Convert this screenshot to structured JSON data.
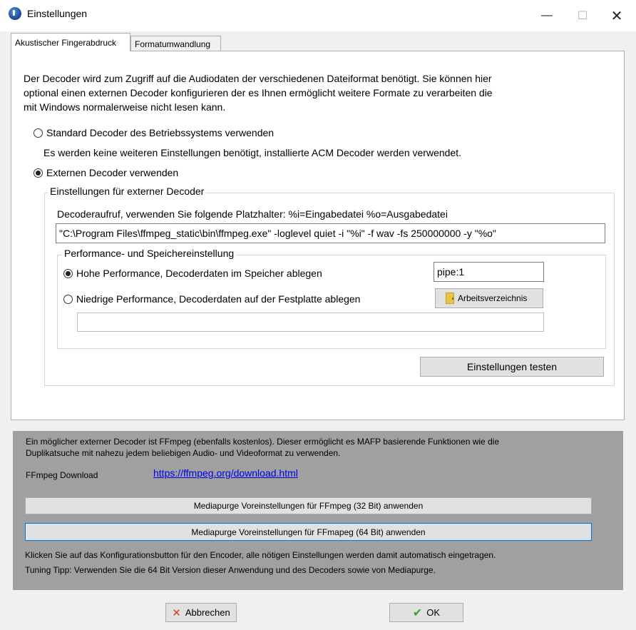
{
  "window": {
    "title": "Einstellungen",
    "minimize_glyph": "—",
    "maximize_glyph": "☐",
    "close_glyph": "✕"
  },
  "tabs": [
    {
      "label": "Akustischer Fingerabdruck",
      "active": true
    },
    {
      "label": "Formatumwandlung",
      "active": false
    }
  ],
  "decoder": {
    "intro_line1": "Der Decoder wird zum Zugriff auf die Audiodaten der verschiedenen Dateiformat benötigt.  Sie können hier",
    "intro_line2": "optional einen externen Decoder konfigurieren der es Ihnen ermöglicht weitere Formate zu verarbeiten die",
    "intro_line3": "mit Windows normalerweise nicht lesen kann.",
    "radio_standard": "Standard Decoder des Betriebssystems verwenden",
    "standard_note": "Es werden keine weiteren Einstellungen benötigt, installierte ACM Decoder werden verwendet.",
    "radio_external": "Externen Decoder verwenden",
    "selected": "external"
  },
  "external": {
    "group_title": "Einstellungen für externer Decoder",
    "call_label": "Decoderaufruf, verwenden Sie folgende Platzhalter: %i=Eingabedatei %o=Ausgabedatei",
    "command_value": "\"C:\\Program Files\\ffmpeg_static\\bin\\ffmpeg.exe\" -loglevel quiet -i \"%i\" -f wav -fs 250000000 -y \"%o\"",
    "perf_group_title": "Performance- und Speichereinstellung",
    "radio_high": "Hohe Performance, Decoderdaten im Speicher ablegen",
    "pipe_value": "pipe:1",
    "radio_low": "Niedrige Performance, Decoderdaten auf der Festplatte ablegen",
    "workdir_button": "Arbeitsverzeichnis",
    "workdir_value": "",
    "perf_selected": "high",
    "test_button": "Einstellungen testen"
  },
  "info": {
    "line1": "Ein möglicher externer Decoder ist FFmpeg (ebenfalls kostenlos). Dieser ermöglicht es MAFP basierende Funktionen wie die",
    "line2": "Duplikatsuche mit nahezu jedem beliebigen Audio- und Videoformat zu verwenden.",
    "download_label": "FFmpeg Download",
    "download_link": "https://ffmpeg.org/download.html",
    "btn_32": "Mediapurge Voreinstellungen für FFmpeg (32 Bit) anwenden",
    "btn_64": "Mediapurge Voreinstellungen für FFmapeg (64 Bit) anwenden",
    "hint1": "Klicken Sie auf das Konfigurationsbutton für den Encoder, alle nötigen Einstellungen werden damit automatisch eingetragen.",
    "hint2": "Tuning Tipp: Verwenden Sie die 64 Bit Version dieser Anwendung und des Decoders sowie von Mediapurge."
  },
  "footer": {
    "cancel_label": "Abbrechen",
    "ok_label": "OK"
  },
  "colors": {
    "info_panel_bg": "#a0a0a0",
    "link": "#0000ee",
    "cancel_icon": "#d93a1a",
    "ok_icon": "#3aa33a",
    "focus_border": "#0078d7"
  }
}
